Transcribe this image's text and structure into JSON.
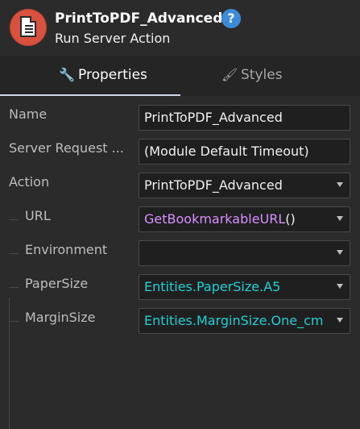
{
  "header": {
    "title": "PrintToPDF_Advanced",
    "subtitle": "Run Server Action",
    "help_symbol": "?"
  },
  "tabs": [
    {
      "label": "Properties",
      "icon": "wrench-icon",
      "active": true
    },
    {
      "label": "Styles",
      "icon": "paintbrush-icon",
      "active": false
    }
  ],
  "rows": [
    {
      "label": "Name",
      "value": "PrintToPDF_Advanced",
      "dropdown": false
    },
    {
      "label": "Server Request ...",
      "value": "(Module Default Timeout)",
      "dropdown": false
    },
    {
      "label": "Action",
      "value": "PrintToPDF_Advanced",
      "dropdown": true
    },
    {
      "label": "URL",
      "value": "GetBookmarkableURL",
      "suffix": "()",
      "dropdown": true
    },
    {
      "label": "Environment",
      "value": "",
      "dropdown": true
    },
    {
      "label": "PaperSize",
      "value": "Entities.PaperSize.A5",
      "dropdown": true
    },
    {
      "label": "MarginSize",
      "value": "Entities.MarginSize.One_cm",
      "dropdown": true
    }
  ],
  "colors": {
    "background": "#2b2b2b",
    "tab_bar": "#252525",
    "active_tab_text": "#ffffff",
    "label": "#bdbdbd",
    "function_value": "#d690ff",
    "entity_value": "#22d0d5",
    "field_background": "#1f1f1f"
  }
}
